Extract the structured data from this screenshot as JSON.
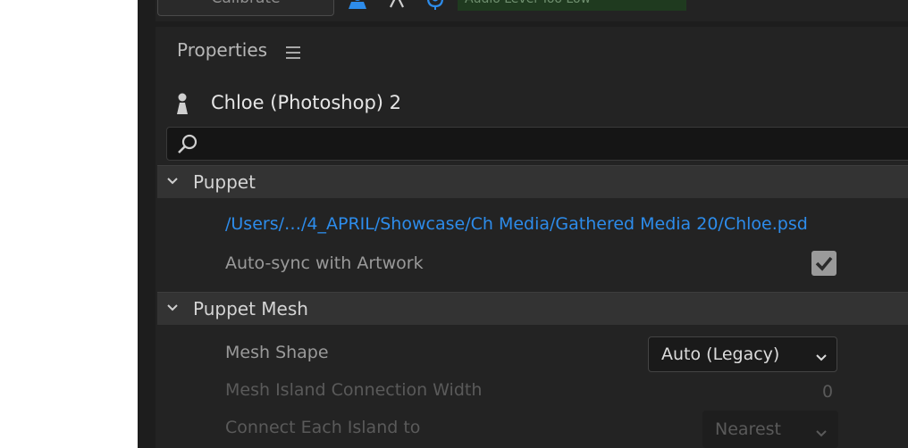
{
  "toolbar": {
    "calibrate_label": "Calibrate",
    "audio_status": "Audio Level Too Low",
    "icons": [
      "person-icon",
      "arms-icon",
      "microphone-icon"
    ]
  },
  "panel": {
    "title": "Properties",
    "menu_icon": "hamburger-icon",
    "puppet_name": "Chloe (Photoshop) 2",
    "search_placeholder": ""
  },
  "sections": [
    {
      "label": "Puppet",
      "file_path": "/Users/…/4_APRIL/Showcase/Ch Media/Gathered Media 20/Chloe.psd",
      "auto_sync_label": "Auto-sync with Artwork",
      "auto_sync_checked": true
    },
    {
      "label": "Puppet Mesh",
      "mesh_shape_label": "Mesh Shape",
      "mesh_shape_value": "Auto (Legacy)",
      "island_width_label": "Mesh Island Connection Width",
      "island_width_value": "0",
      "connect_label": "Connect Each Island to",
      "connect_value": "Nearest"
    }
  ],
  "colors": {
    "accent_link": "#2d8ceb",
    "toolbar_accent": "#2d8ceb",
    "audio_meter_bg": "#1f3a1f"
  }
}
